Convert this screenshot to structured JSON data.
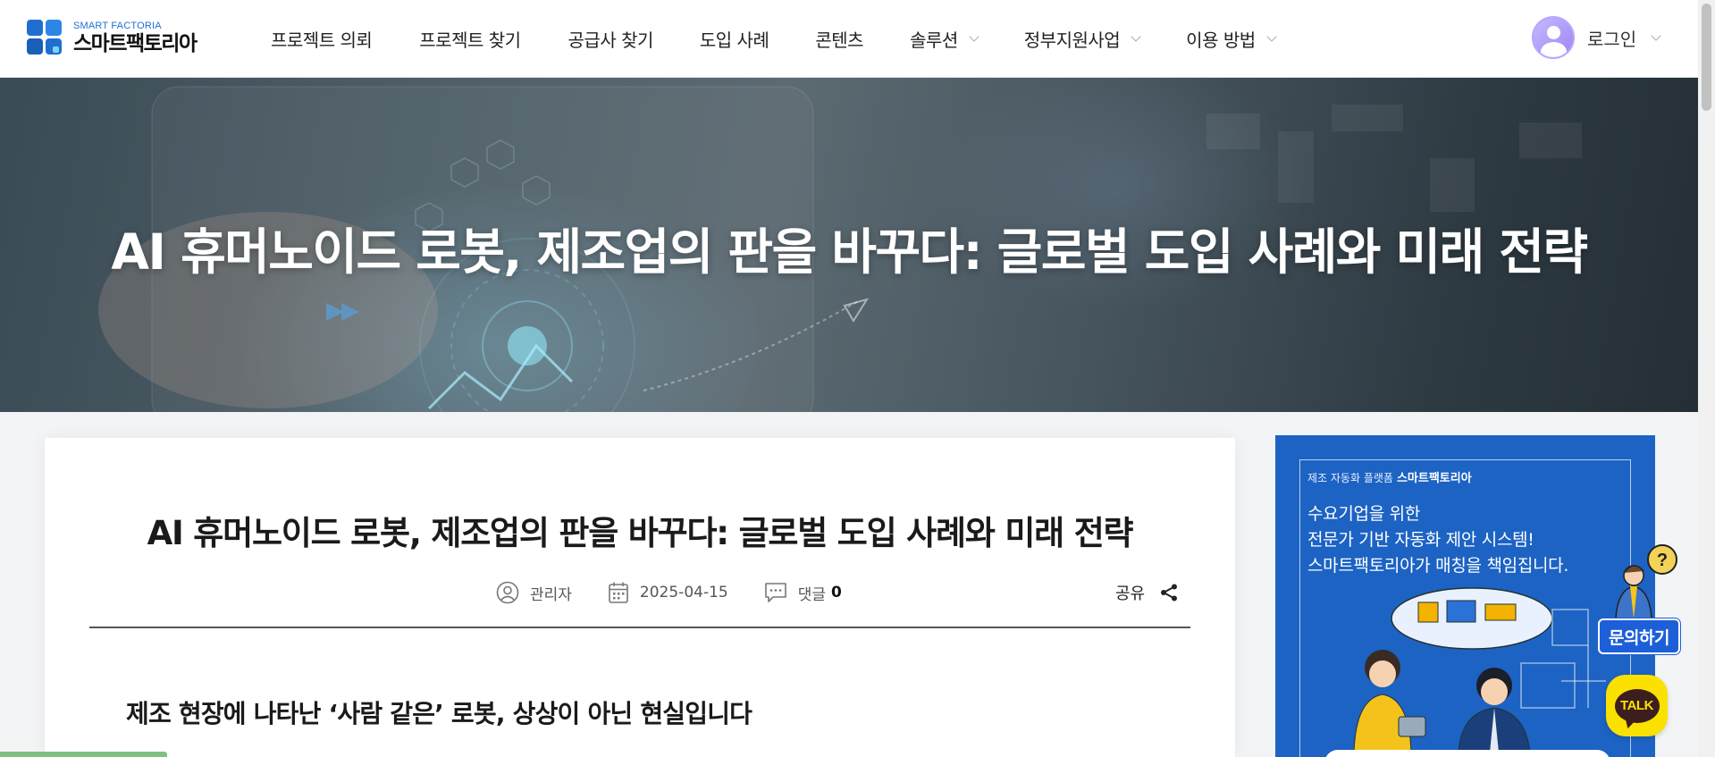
{
  "header": {
    "logo_en": "SMART FACTORIA",
    "logo_ko": "스마트팩토리아",
    "nav": [
      {
        "label": "프로젝트 의뢰",
        "has_dropdown": false
      },
      {
        "label": "프로젝트 찾기",
        "has_dropdown": false
      },
      {
        "label": "공급사 찾기",
        "has_dropdown": false
      },
      {
        "label": "도입 사례",
        "has_dropdown": false
      },
      {
        "label": "콘텐츠",
        "has_dropdown": false
      },
      {
        "label": "솔루션",
        "has_dropdown": true
      },
      {
        "label": "정부지원사업",
        "has_dropdown": true
      },
      {
        "label": "이용 방법",
        "has_dropdown": true
      }
    ],
    "login_label": "로그인"
  },
  "hero": {
    "title": "AI 휴머노이드 로봇, 제조업의 판을 바꾸다: 글로벌 도입 사례와 미래 전략"
  },
  "article": {
    "title": "AI 휴머노이드 로봇, 제조업의 판을 바꾸다: 글로벌 도입 사례와 미래 전략",
    "author": "관리자",
    "date": "2025-04-15",
    "comments_label": "댓글",
    "comments_count": "0",
    "share_label": "공유",
    "section_heading": "제조 현장에 나타난 ‘사람 같은’ 로봇, 상상이 아닌 현실입니다"
  },
  "ad": {
    "kicker": "제조 자동화 플랫폼",
    "kicker_brand": "스마트팩토리아",
    "lines": [
      "수요기업을 위한",
      "전문가 기반 자동화 제안 시스템!",
      "스마트팩토리아가 매칭을 책임집니다."
    ]
  },
  "floating": {
    "help_label": "문의하기",
    "talk_label": "TALK"
  },
  "colors": {
    "brand_blue": "#1f6fd1",
    "ad_blue": "#1c63c4",
    "help_blue": "#1d5fd9",
    "kakao_yellow": "#fae100"
  }
}
